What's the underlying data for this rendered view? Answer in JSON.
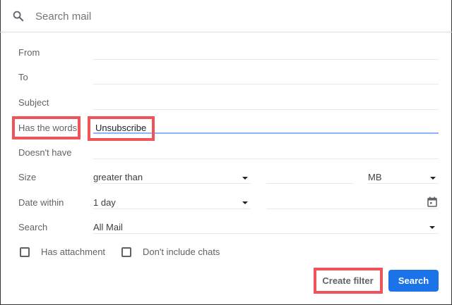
{
  "search": {
    "placeholder": "Search mail"
  },
  "fields": {
    "from": {
      "label": "From",
      "value": ""
    },
    "to": {
      "label": "To",
      "value": ""
    },
    "subject": {
      "label": "Subject",
      "value": ""
    },
    "has_words": {
      "label": "Has the words",
      "value": "Unsubscribe"
    },
    "doesnt_have": {
      "label": "Doesn't have",
      "value": ""
    },
    "size": {
      "label": "Size",
      "operator": "greater than",
      "value": "",
      "unit": "MB"
    },
    "date_within": {
      "label": "Date within",
      "value": "1 day",
      "date": ""
    },
    "search_in": {
      "label": "Search",
      "value": "All Mail"
    }
  },
  "checkboxes": {
    "has_attachment": {
      "label": "Has attachment",
      "checked": false
    },
    "no_chats": {
      "label": "Don't include chats",
      "checked": false
    }
  },
  "buttons": {
    "create_filter": "Create filter",
    "search": "Search"
  },
  "colors": {
    "accent": "#1a73e8",
    "highlight": "#ef5459",
    "focus_line": "#8ab4f8"
  }
}
